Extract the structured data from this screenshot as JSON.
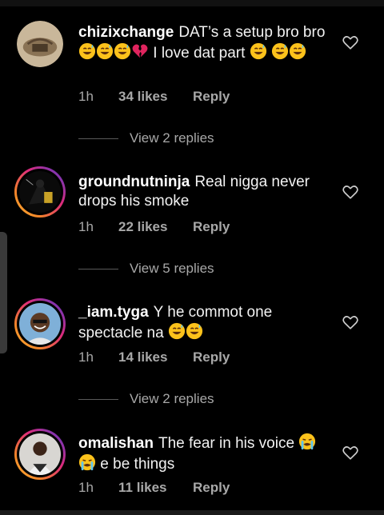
{
  "comments": [
    {
      "username": "chizixchange",
      "text1": "DAT’s a setup bro bro",
      "text2": "I love dat part",
      "time": "1h",
      "likes": "34 likes",
      "reply": "Reply",
      "view_replies": "View 2 replies"
    },
    {
      "username": "groundnutninja",
      "text1": "Real nigga never drops his smoke",
      "time": "1h",
      "likes": "22 likes",
      "reply": "Reply",
      "view_replies": "View 5 replies"
    },
    {
      "username": "_iam.tyga",
      "text1": "Y he commot one spectacle na",
      "time": "1h",
      "likes": "14 likes",
      "reply": "Reply",
      "view_replies": "View 2 replies"
    },
    {
      "username": "omalishan",
      "text1": "The fear in his voice",
      "text2": "e be things",
      "time": "1h",
      "likes": "11 likes",
      "reply": "Reply"
    }
  ],
  "icons": {
    "heart": "heart-outline-icon",
    "laugh": "grinning-sweat-emoji",
    "tears": "tears-of-joy-emoji",
    "crying": "loudly-crying-emoji",
    "broken_heart": "broken-heart-emoji"
  },
  "colors": {
    "background": "#000000",
    "text": "#f2f2f2",
    "muted": "#a8a8a8",
    "broken_heart": "#e0245e",
    "emoji_yellow": "#fcc21b"
  }
}
